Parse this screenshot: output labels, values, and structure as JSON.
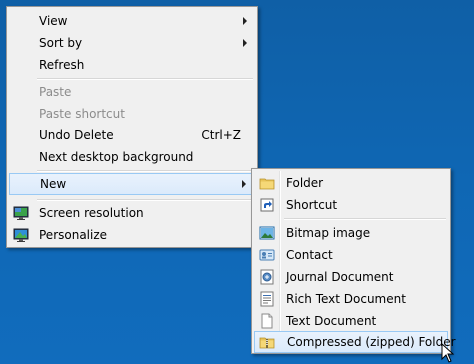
{
  "context_menu": {
    "items": [
      {
        "label": "View",
        "has_submenu": true
      },
      {
        "label": "Sort by",
        "has_submenu": true
      },
      {
        "label": "Refresh"
      },
      {
        "label": "Paste",
        "disabled": true
      },
      {
        "label": "Paste shortcut",
        "disabled": true
      },
      {
        "label": "Undo Delete",
        "shortcut": "Ctrl+Z"
      },
      {
        "label": "Next desktop background"
      },
      {
        "label": "New",
        "has_submenu": true,
        "highlighted": true
      },
      {
        "label": "Screen resolution",
        "icon": "screen-resolution-icon"
      },
      {
        "label": "Personalize",
        "icon": "personalize-icon"
      }
    ]
  },
  "new_submenu": {
    "items": [
      {
        "label": "Folder",
        "icon": "folder-icon"
      },
      {
        "label": "Shortcut",
        "icon": "shortcut-icon"
      },
      {
        "label": "Bitmap image",
        "icon": "bitmap-image-icon"
      },
      {
        "label": "Contact",
        "icon": "contact-icon"
      },
      {
        "label": "Journal Document",
        "icon": "journal-document-icon"
      },
      {
        "label": "Rich Text Document",
        "icon": "rich-text-document-icon"
      },
      {
        "label": "Text Document",
        "icon": "text-document-icon"
      },
      {
        "label": "Compressed (zipped) Folder",
        "icon": "zipped-folder-icon",
        "highlighted": true
      }
    ]
  },
  "colors": {
    "desktop_background": "#0f67b4",
    "menu_background": "#f0f0f0",
    "highlight_border": "#99c9f4",
    "disabled_text": "#8c8c8c"
  }
}
